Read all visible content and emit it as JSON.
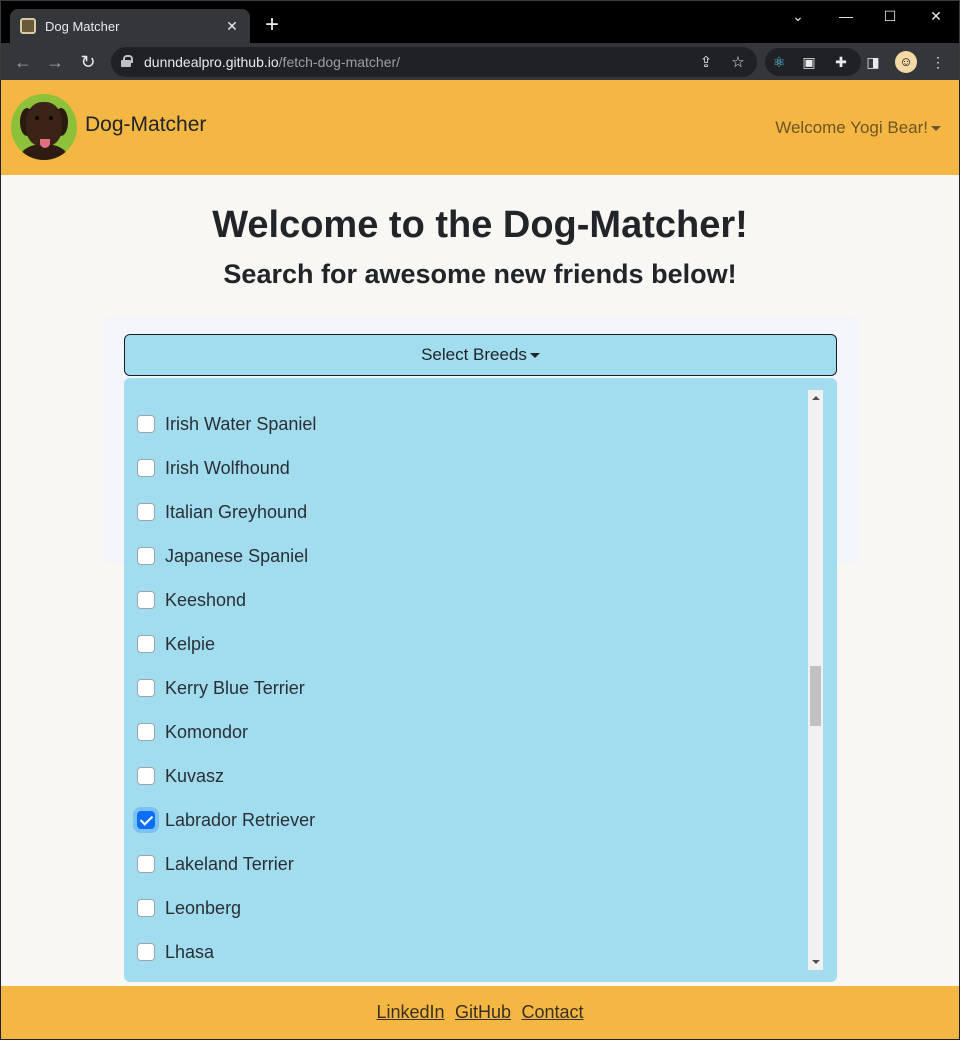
{
  "browser": {
    "tab_title": "Dog Matcher",
    "tab_close": "✕",
    "new_tab": "+",
    "url_host": "dunndealpro.github.io",
    "url_path": "/fetch-dog-matcher/",
    "controls": {
      "minimize": "—",
      "maximize": "☐",
      "close": "✕",
      "collapse": "⌄"
    }
  },
  "navbar": {
    "brand": "Dog-Matcher",
    "welcome": "Welcome Yogi Bear!"
  },
  "hero": {
    "title": "Welcome to the Dog-Matcher!",
    "subtitle": "Search for awesome new friends below!"
  },
  "breed_select": {
    "label": "Select Breeds",
    "options": [
      {
        "name": "Irish Water Spaniel",
        "checked": false
      },
      {
        "name": "Irish Wolfhound",
        "checked": false
      },
      {
        "name": "Italian Greyhound",
        "checked": false
      },
      {
        "name": "Japanese Spaniel",
        "checked": false
      },
      {
        "name": "Keeshond",
        "checked": false
      },
      {
        "name": "Kelpie",
        "checked": false
      },
      {
        "name": "Kerry Blue Terrier",
        "checked": false
      },
      {
        "name": "Komondor",
        "checked": false
      },
      {
        "name": "Kuvasz",
        "checked": false
      },
      {
        "name": "Labrador Retriever",
        "checked": true
      },
      {
        "name": "Lakeland Terrier",
        "checked": false
      },
      {
        "name": "Leonberg",
        "checked": false
      },
      {
        "name": "Lhasa",
        "checked": false
      }
    ]
  },
  "footer": {
    "links": [
      "LinkedIn",
      "GitHub",
      "Contact"
    ]
  },
  "colors": {
    "navbar": "#f5b743",
    "dropdown": "#a1dcef",
    "checkbox_checked": "#0d6efd",
    "page_bg": "#f8f7f3"
  }
}
